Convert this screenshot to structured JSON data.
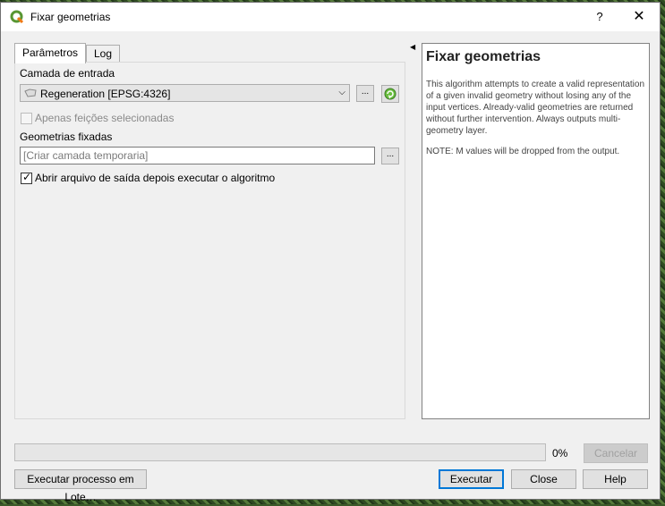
{
  "window": {
    "title": "Fixar geometrias",
    "help_glyph": "?",
    "close_glyph": "✕"
  },
  "tabs": [
    {
      "label": "Parâmetros",
      "active": true
    },
    {
      "label": "Log",
      "active": false
    }
  ],
  "form": {
    "input_layer_label": "Camada de entrada",
    "input_layer_value": "Regeneration [EPSG:4326]",
    "browse_label": "...",
    "selected_only_label": "Apenas feições selecionadas",
    "selected_only_checked": false,
    "output_label": "Geometrias fixadas",
    "output_placeholder": "[Criar camada temporaria]",
    "output_value": "",
    "open_output_label": "Abrir arquivo de saída depois executar o algoritmo",
    "open_output_checked": true
  },
  "help": {
    "title": "Fixar geometrias",
    "body": "This algorithm attempts to create a valid representation of a given invalid geometry without losing any of the input vertices. Already-valid geometries are returned without further intervention. Always outputs multi-geometry layer.",
    "note": "NOTE: M values will be dropped from the output."
  },
  "progress": {
    "value": 0,
    "label": "0%"
  },
  "buttons": {
    "cancel": "Cancelar",
    "batch": "Executar processo em Lote…",
    "run": "Executar",
    "close": "Close",
    "help": "Help"
  },
  "colors": {
    "accent": "#0078d7",
    "qgis_green": "#589632",
    "progress_fill": "#06b025"
  }
}
